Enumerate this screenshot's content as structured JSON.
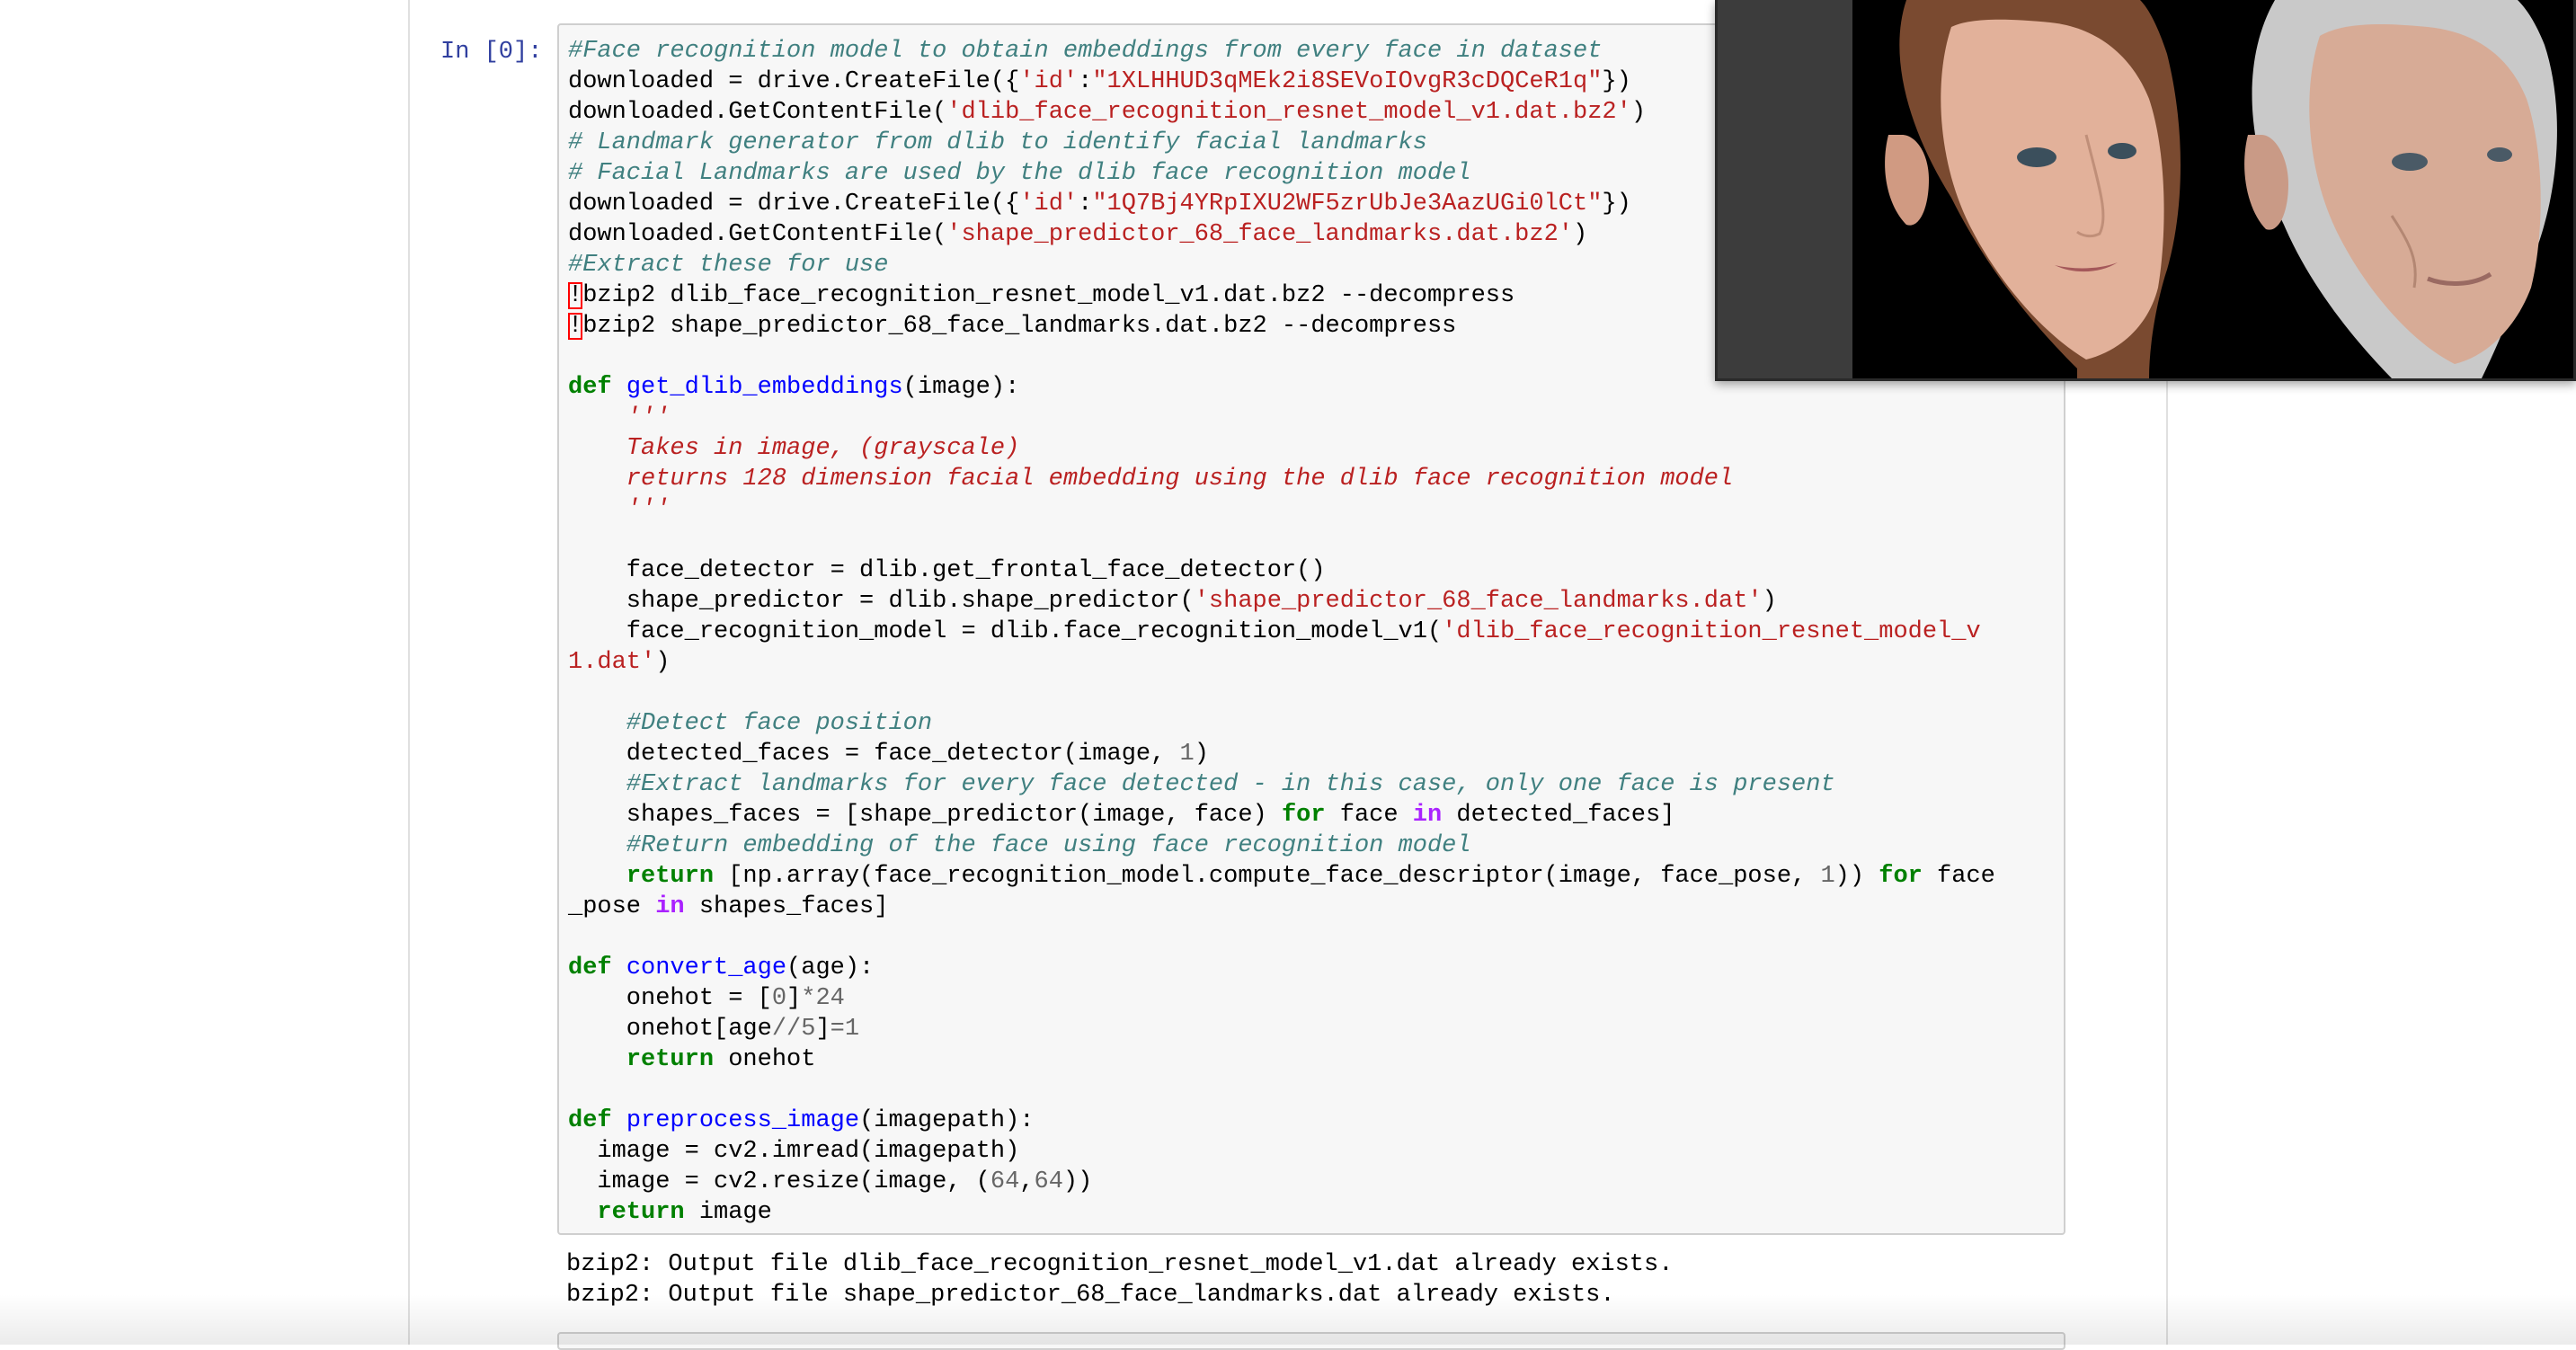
{
  "cell": {
    "prompt": "In [0]:",
    "code_lines": [
      [
        {
          "t": "#Face recognition model to obtain embeddings from every face in dataset",
          "c": "c"
        }
      ],
      [
        {
          "t": "downloaded = drive.CreateFile({",
          "c": ""
        },
        {
          "t": "'id'",
          "c": "s"
        },
        {
          "t": ":",
          "c": ""
        },
        {
          "t": "\"1XLHHUD3qMEk2i8SEVoIOvgR3cDQCeR1q\"",
          "c": "s"
        },
        {
          "t": "})",
          "c": ""
        }
      ],
      [
        {
          "t": "downloaded.GetContentFile(",
          "c": ""
        },
        {
          "t": "'dlib_face_recognition_resnet_model_v1.dat.bz2'",
          "c": "s"
        },
        {
          "t": ")",
          "c": ""
        }
      ],
      [
        {
          "t": "# Landmark generator from dlib to identify facial landmarks",
          "c": "c"
        }
      ],
      [
        {
          "t": "# Facial Landmarks are used by the dlib face recognition model",
          "c": "c"
        }
      ],
      [
        {
          "t": "downloaded = drive.CreateFile({",
          "c": ""
        },
        {
          "t": "'id'",
          "c": "s"
        },
        {
          "t": ":",
          "c": ""
        },
        {
          "t": "\"1Q7Bj4YRpIXU2WF5zrUbJe3AazUGi0lCt\"",
          "c": "s"
        },
        {
          "t": "})",
          "c": ""
        }
      ],
      [
        {
          "t": "downloaded.GetContentFile(",
          "c": ""
        },
        {
          "t": "'shape_predictor_68_face_landmarks.dat.bz2'",
          "c": "s"
        },
        {
          "t": ")",
          "c": ""
        }
      ],
      [
        {
          "t": "#Extract these for use",
          "c": "c"
        }
      ],
      [
        {
          "t": "!",
          "c": "bang"
        },
        {
          "t": "bzip2 dlib_face_recognition_resnet_model_v1.dat.bz2 --decompress",
          "c": ""
        }
      ],
      [
        {
          "t": "!",
          "c": "bang"
        },
        {
          "t": "bzip2 shape_predictor_68_face_landmarks.dat.bz2 --decompress",
          "c": ""
        }
      ],
      [],
      [
        {
          "t": "def",
          "c": "k"
        },
        {
          "t": " ",
          "c": ""
        },
        {
          "t": "get_dlib_embeddings",
          "c": "nf"
        },
        {
          "t": "(image):",
          "c": ""
        }
      ],
      [
        {
          "t": "    '''",
          "c": "sd"
        }
      ],
      [
        {
          "t": "    Takes in image, (grayscale)",
          "c": "sd"
        }
      ],
      [
        {
          "t": "    returns 128 dimension facial embedding using the dlib face recognition model",
          "c": "sd"
        }
      ],
      [
        {
          "t": "    '''",
          "c": "sd"
        }
      ],
      [],
      [
        {
          "t": "    face_detector = dlib.get_frontal_face_detector()",
          "c": ""
        }
      ],
      [
        {
          "t": "    shape_predictor = dlib.shape_predictor(",
          "c": ""
        },
        {
          "t": "'shape_predictor_68_face_landmarks.dat'",
          "c": "s"
        },
        {
          "t": ")",
          "c": ""
        }
      ],
      [
        {
          "t": "    face_recognition_model = dlib.face_recognition_model_v1(",
          "c": ""
        },
        {
          "t": "'dlib_face_recognition_resnet_model_v",
          "c": "s"
        }
      ],
      [
        {
          "t": "1.dat'",
          "c": "s"
        },
        {
          "t": ")",
          "c": ""
        }
      ],
      [],
      [
        {
          "t": "    #Detect face position",
          "c": "c"
        }
      ],
      [
        {
          "t": "    detected_faces = face_detector(image, ",
          "c": ""
        },
        {
          "t": "1",
          "c": "m"
        },
        {
          "t": ")",
          "c": ""
        }
      ],
      [
        {
          "t": "    #Extract landmarks for every face detected - in this case, only one face is present",
          "c": "c"
        }
      ],
      [
        {
          "t": "    shapes_faces = [shape_predictor(image, face) ",
          "c": ""
        },
        {
          "t": "for",
          "c": "k"
        },
        {
          "t": " face ",
          "c": ""
        },
        {
          "t": "in",
          "c": "ow"
        },
        {
          "t": " detected_faces]",
          "c": ""
        }
      ],
      [
        {
          "t": "    #Return embedding of the face using face recognition model",
          "c": "c"
        }
      ],
      [
        {
          "t": "    ",
          "c": ""
        },
        {
          "t": "return",
          "c": "k"
        },
        {
          "t": " [np.array(face_recognition_model.compute_face_descriptor(image, face_pose, ",
          "c": ""
        },
        {
          "t": "1",
          "c": "m"
        },
        {
          "t": ")) ",
          "c": ""
        },
        {
          "t": "for",
          "c": "k"
        },
        {
          "t": " face",
          "c": ""
        }
      ],
      [
        {
          "t": "_pose ",
          "c": ""
        },
        {
          "t": "in",
          "c": "ow"
        },
        {
          "t": " shapes_faces]",
          "c": ""
        }
      ],
      [],
      [
        {
          "t": "def",
          "c": "k"
        },
        {
          "t": " ",
          "c": ""
        },
        {
          "t": "convert_age",
          "c": "nf"
        },
        {
          "t": "(age):",
          "c": ""
        }
      ],
      [
        {
          "t": "    onehot = [",
          "c": ""
        },
        {
          "t": "0",
          "c": "m"
        },
        {
          "t": "]",
          "c": ""
        },
        {
          "t": "*",
          "c": "m"
        },
        {
          "t": "24",
          "c": "m"
        }
      ],
      [
        {
          "t": "    onehot[age",
          "c": ""
        },
        {
          "t": "//",
          "c": "m"
        },
        {
          "t": "5",
          "c": "m"
        },
        {
          "t": "]",
          "c": ""
        },
        {
          "t": "=",
          "c": "m"
        },
        {
          "t": "1",
          "c": "m"
        }
      ],
      [
        {
          "t": "    ",
          "c": ""
        },
        {
          "t": "return",
          "c": "k"
        },
        {
          "t": " onehot",
          "c": ""
        }
      ],
      [],
      [
        {
          "t": "def",
          "c": "k"
        },
        {
          "t": " ",
          "c": ""
        },
        {
          "t": "preprocess_image",
          "c": "nf"
        },
        {
          "t": "(imagepath):",
          "c": ""
        }
      ],
      [
        {
          "t": "  image = cv2.imread(imagepath)",
          "c": ""
        }
      ],
      [
        {
          "t": "  image = cv2.resize(image, (",
          "c": ""
        },
        {
          "t": "64",
          "c": "m"
        },
        {
          "t": ",",
          "c": ""
        },
        {
          "t": "64",
          "c": "m"
        },
        {
          "t": "))",
          "c": ""
        }
      ],
      [
        {
          "t": "  ",
          "c": ""
        },
        {
          "t": "return",
          "c": "k"
        },
        {
          "t": " image",
          "c": ""
        }
      ]
    ],
    "output_lines": [
      "bzip2: Output file dlib_face_recognition_resnet_model_v1.dat already exists.",
      "bzip2: Output file shape_predictor_68_face_landmarks.dat already exists."
    ]
  },
  "pip_video": {
    "description_icon": "video-overlay",
    "background": "#000000",
    "skin_young": "#e2b19a",
    "skin_old": "#d7ab96",
    "hair_young": "#5a3a24",
    "hair_old": "#c9c9c9"
  },
  "colors": {
    "comment": "#408080",
    "string": "#ba2121",
    "keyword": "#008000",
    "operator_word": "#aa22ff",
    "function_name": "#0000ff",
    "number": "#666666",
    "prompt": "#303f9f",
    "cell_bg": "#f7f7f7"
  }
}
